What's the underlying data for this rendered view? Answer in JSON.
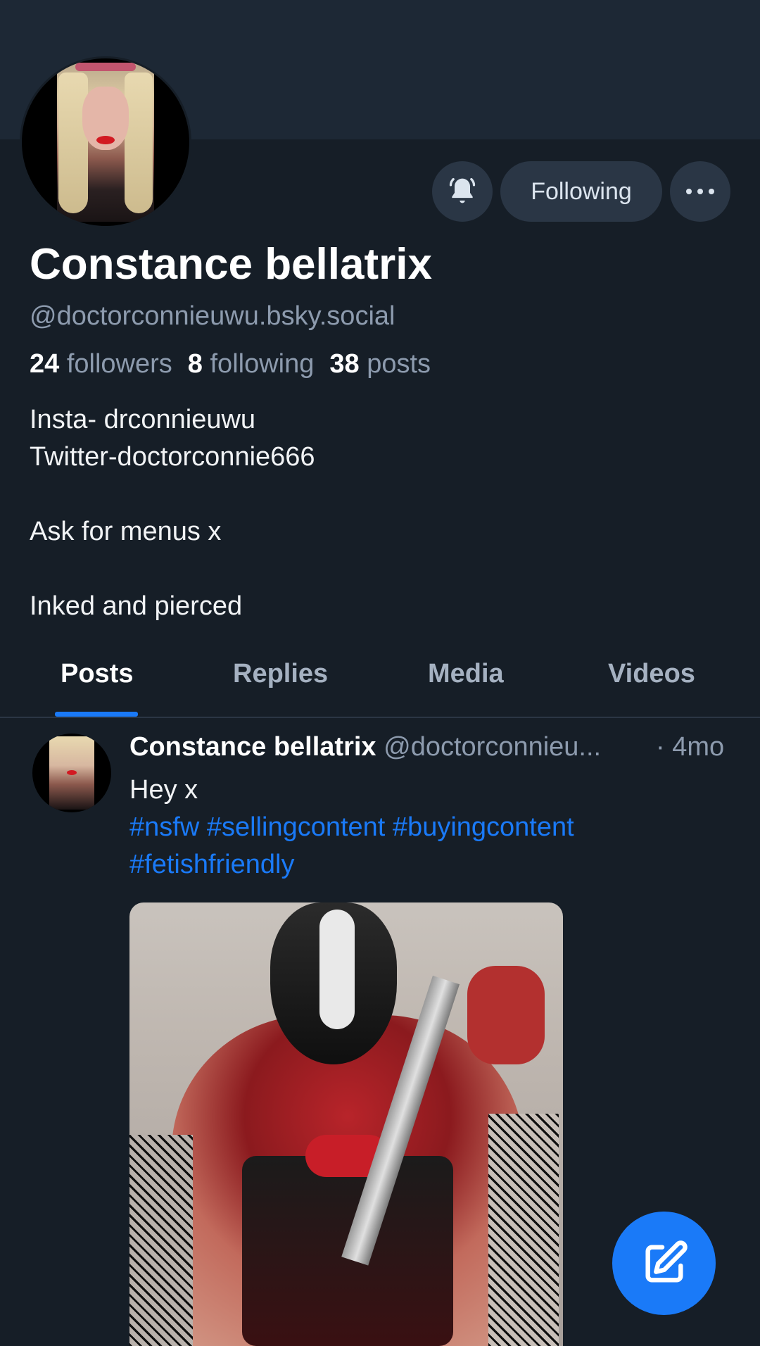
{
  "profile": {
    "name": "Constance bellatrix",
    "handle": "@doctorconnieuwu.bsky.social",
    "avatar_icon": "profile-photo",
    "stats": {
      "followers_count": "24",
      "followers_label": "followers",
      "following_count": "8",
      "following_label": "following",
      "posts_count": "38",
      "posts_label": "posts"
    },
    "bio": {
      "line1": "Insta- drconnieuwu",
      "line2": "Twitter-doctorconnie666",
      "line3": "",
      "line4": "Ask for menus x",
      "line5": "",
      "line6": "Inked and pierced"
    }
  },
  "actions": {
    "bell_icon": "bell-icon",
    "following_label": "Following",
    "more_icon": "more-dots-icon"
  },
  "tabs": [
    {
      "label": "Posts",
      "active": true
    },
    {
      "label": "Replies",
      "active": false
    },
    {
      "label": "Media",
      "active": false
    },
    {
      "label": "Videos",
      "active": false
    }
  ],
  "post": {
    "author": "Constance bellatrix",
    "handle": "@doctorconnieu...",
    "time": "· 4mo",
    "text": "Hey x",
    "tags": [
      "#nsfw",
      "#sellingcontent",
      "#buyingcontent",
      "#fetishfriendly"
    ]
  },
  "fab": {
    "icon": "compose-icon"
  },
  "colors": {
    "background": "#161e27",
    "banner": "#1d2835",
    "accent": "#1a7af8",
    "muted_text": "#8d9bae",
    "button_bg": "#2a3645"
  }
}
